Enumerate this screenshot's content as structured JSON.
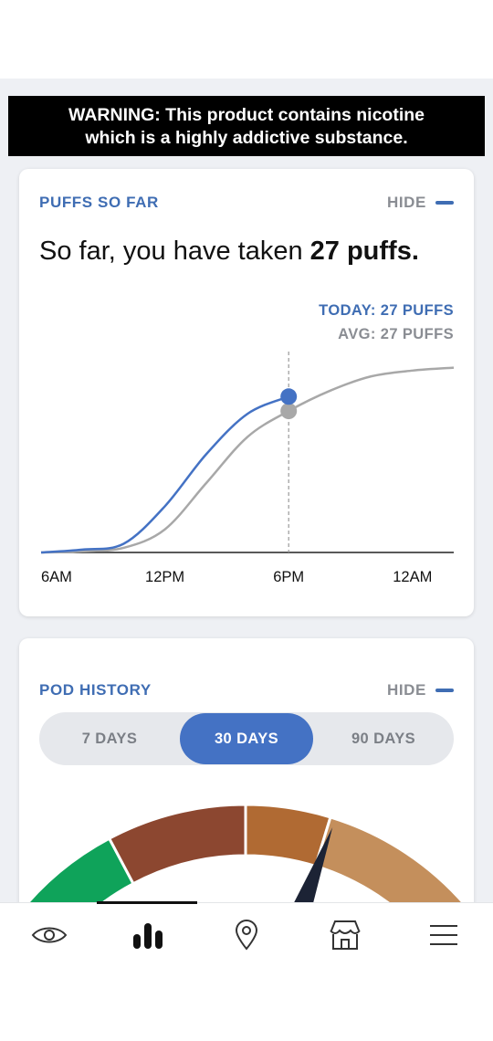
{
  "warning": {
    "line1": "WARNING: This product contains nicotine",
    "line2": "which is a highly addictive substance."
  },
  "puffs_card": {
    "title": "PUFFS SO FAR",
    "hide_label": "HIDE",
    "headline_prefix": "So far, you have taken ",
    "headline_bold": "27 puffs.",
    "today_label": "TODAY: 27 PUFFS",
    "avg_label": "AVG: 27 PUFFS",
    "colors": {
      "today": "#4472c4",
      "avg": "#a8a8a8"
    }
  },
  "chart_data": {
    "type": "line",
    "x_ticks": [
      "6AM",
      "12PM",
      "6PM",
      "12AM"
    ],
    "current_time_marker": "6PM",
    "series": [
      {
        "name": "TODAY",
        "x": [
          "6AM",
          "8AM",
          "10AM",
          "12PM",
          "2PM",
          "4PM",
          "6PM"
        ],
        "values": [
          0,
          0.5,
          1.5,
          8,
          17,
          24,
          27
        ]
      },
      {
        "name": "AVG",
        "x": [
          "6AM",
          "8AM",
          "10AM",
          "12PM",
          "2PM",
          "4PM",
          "6PM",
          "8PM",
          "10PM",
          "12AM",
          "2AM"
        ],
        "values": [
          0,
          0.2,
          0.8,
          4,
          12,
          20,
          24.5,
          28,
          30.5,
          31.5,
          32
        ]
      }
    ],
    "grid": false
  },
  "pod_card": {
    "title": "POD HISTORY",
    "hide_label": "HIDE",
    "range_options": [
      "7 DAYS",
      "30 DAYS",
      "90 DAYS"
    ],
    "selected_range": "30 DAYS",
    "gauge_colors": [
      "#0fa35a",
      "#8c4730",
      "#b06a33",
      "#c48f5c"
    ],
    "needle_color": "#1c2335"
  },
  "tabbar": {
    "items": [
      "eye-icon",
      "bar-chart-icon",
      "location-pin-icon",
      "store-icon",
      "menu-icon"
    ],
    "active": "bar-chart-icon"
  }
}
